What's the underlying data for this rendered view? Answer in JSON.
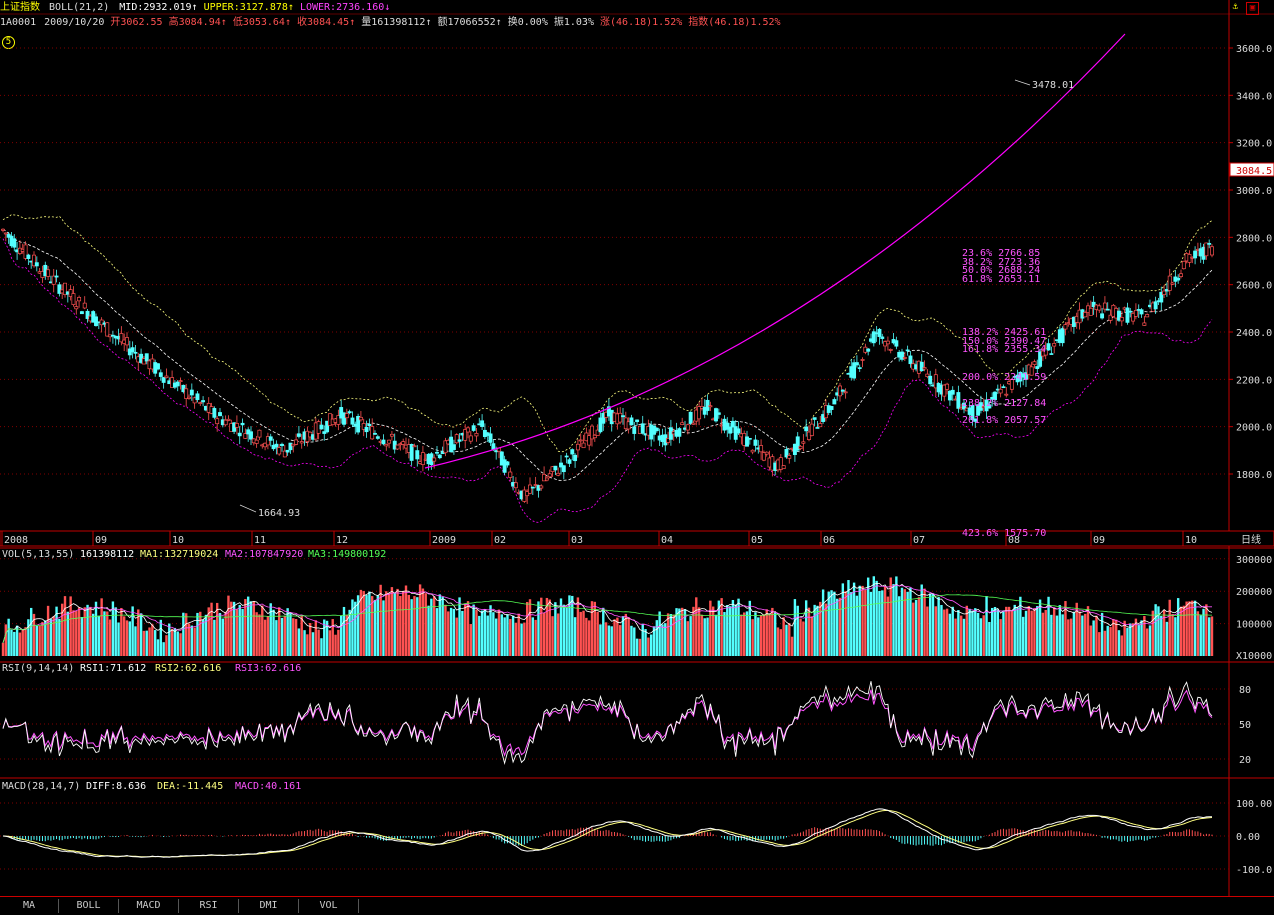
{
  "header": {
    "name": "上证指数",
    "boll_label": "BOLL(21,2)",
    "boll_mid": "MID:2932.019",
    "boll_upper": "UPPER:3127.878",
    "boll_lower": "LOWER:2736.160",
    "code": "1A0001",
    "date": "2009/10/20",
    "open": "开3062.55",
    "high": "高3084.94",
    "low": "低3053.64",
    "close": "收3084.45",
    "volume": "量161398112",
    "amount": "额17066552",
    "turnover": "换0.00%",
    "amplitude": "振1.03%",
    "change": "涨(46.18)1.52%",
    "index_change": "指数(46.18)1.52%",
    "circle_num": "5"
  },
  "price_axis": [
    "3600.0",
    "3400.0",
    "3200.0",
    "3000.0",
    "2800.0",
    "2600.0",
    "2400.0",
    "2200.0",
    "2000.0",
    "1800.0"
  ],
  "current_price": "3084.5",
  "annotations": {
    "high_label": "3478.01",
    "low_label": "1664.93",
    "fib": [
      {
        "text": "23.6% 2766.85",
        "color": "#ff55ff"
      },
      {
        "text": "38.2% 2723.36",
        "color": "#ff55ff"
      },
      {
        "text": "50.0% 2688.24",
        "color": "#ff55ff"
      },
      {
        "text": "61.8% 2653.11",
        "color": "#ff55ff"
      },
      {
        "text": "138.2% 2425.61",
        "color": "#ff55ff"
      },
      {
        "text": "150.0% 2390.47",
        "color": "#ff55ff"
      },
      {
        "text": "161.8% 2355.34",
        "color": "#ff55ff"
      },
      {
        "text": "200.0% 2241.59",
        "color": "#ff55ff"
      },
      {
        "text": "238.2% 2127.84",
        "color": "#ff55ff"
      },
      {
        "text": "261.8% 2057.57",
        "color": "#ff55ff"
      },
      {
        "text": "423.6% 1575.70",
        "color": "#ff55ff"
      }
    ]
  },
  "date_axis": [
    "2008",
    "09",
    "10",
    "11",
    "12",
    "2009",
    "02",
    "03",
    "04",
    "05",
    "06",
    "07",
    "08",
    "09",
    "10"
  ],
  "period_label": "日线",
  "vol": {
    "label": "VOL(5,13,55)",
    "value": "161398112",
    "ma1": "MA1:132719024",
    "ma2": "MA2:107847920",
    "ma3": "MA3:149800192",
    "axis": [
      "300000",
      "200000",
      "100000"
    ],
    "unit": "X10000"
  },
  "rsi": {
    "label": "RSI(9,14,14)",
    "rsi1": "RSI1:71.612",
    "rsi2": "RSI2:62.616",
    "rsi3": "RSI3:62.616",
    "axis": [
      "80",
      "50",
      "20"
    ]
  },
  "macd": {
    "label": "MACD(28,14,7)",
    "diff": "DIFF:8.636",
    "dea": "DEA:-11.445",
    "macd": "MACD:40.161",
    "axis": [
      "100.00",
      "0.00",
      "-100.0"
    ]
  },
  "tabs": [
    "MA",
    "BOLL",
    "MACD",
    "RSI",
    "DMI",
    "VOL"
  ],
  "colors": {
    "up": "#ff5252",
    "down": "#54ffff",
    "grid": "#800000",
    "border": "#c00000",
    "boll": "#ffff80",
    "lower_boll": "#ff00ff",
    "trend": "#ff00ff"
  },
  "icons": {
    "anchor": "anchor-icon",
    "window": "window-icon"
  }
}
